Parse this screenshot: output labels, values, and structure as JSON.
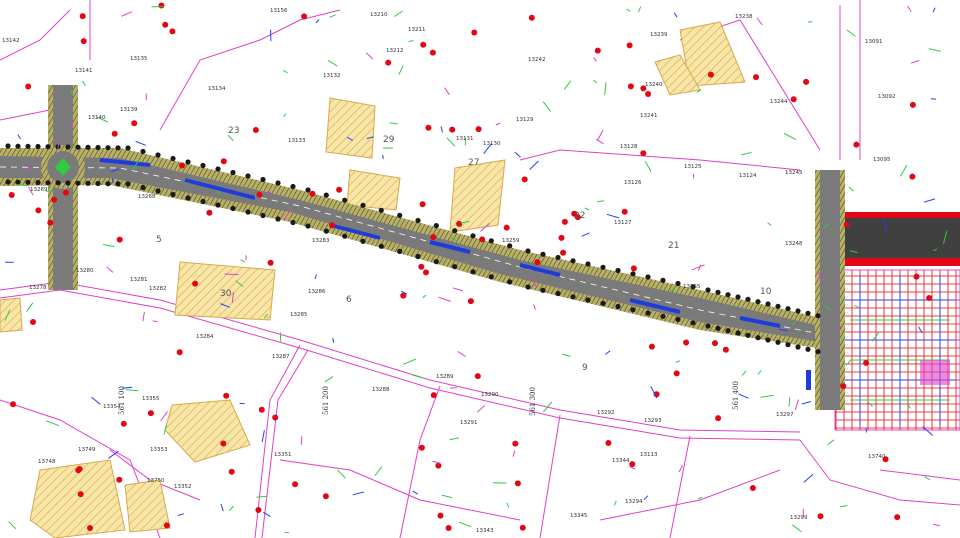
{
  "map": {
    "colors": {
      "background": "#ffffff",
      "property_lines": "#e040c8",
      "road_paving": "#7a7a7a",
      "road_edge_hatch": "#c8c070",
      "bus_lane": "#1e3cd8",
      "building_fill": "#f7e6a8",
      "building_hatch": "#d9a84a",
      "marker_red": "#e30613",
      "vegetation_green": "#2ecc40",
      "blue_features": "#1e40ff",
      "dark_block": "#404040"
    },
    "block_numbers": [
      "23",
      "29",
      "27",
      "22",
      "21",
      "10",
      "5",
      "30",
      "6",
      "9"
    ],
    "stations": [
      "561 100",
      "561 200",
      "561 300",
      "561 400"
    ],
    "parcels": [
      {
        "id": "13142"
      },
      {
        "id": "13141"
      },
      {
        "id": "13135"
      },
      {
        "id": "13156"
      },
      {
        "id": "13210"
      },
      {
        "id": "13211"
      },
      {
        "id": "13212"
      },
      {
        "id": "13134"
      },
      {
        "id": "13132"
      },
      {
        "id": "13139"
      },
      {
        "id": "13140"
      },
      {
        "id": "13133"
      },
      {
        "id": "13131"
      },
      {
        "id": "13130"
      },
      {
        "id": "13129"
      },
      {
        "id": "13242"
      },
      {
        "id": "13238"
      },
      {
        "id": "13239"
      },
      {
        "id": "13240"
      },
      {
        "id": "13241"
      },
      {
        "id": "13244"
      },
      {
        "id": "13091"
      },
      {
        "id": "13092"
      },
      {
        "id": "13128"
      },
      {
        "id": "13126"
      },
      {
        "id": "13125"
      },
      {
        "id": "13124"
      },
      {
        "id": "13245"
      },
      {
        "id": "13095"
      },
      {
        "id": "13127"
      },
      {
        "id": "13248"
      },
      {
        "id": "13269"
      },
      {
        "id": "13268"
      },
      {
        "id": "13283"
      },
      {
        "id": "13259"
      },
      {
        "id": "13280"
      },
      {
        "id": "13281"
      },
      {
        "id": "13282"
      },
      {
        "id": "13278"
      },
      {
        "id": "13286"
      },
      {
        "id": "13285"
      },
      {
        "id": "13255"
      },
      {
        "id": "13284"
      },
      {
        "id": "13287"
      },
      {
        "id": "13288"
      },
      {
        "id": "13289"
      },
      {
        "id": "13290"
      },
      {
        "id": "13292"
      },
      {
        "id": "13293"
      },
      {
        "id": "13291"
      },
      {
        "id": "13297"
      },
      {
        "id": "13740"
      },
      {
        "id": "13354"
      },
      {
        "id": "13355"
      },
      {
        "id": "13353"
      },
      {
        "id": "13749"
      },
      {
        "id": "13748"
      },
      {
        "id": "13750"
      },
      {
        "id": "13352"
      },
      {
        "id": "13351"
      },
      {
        "id": "13344"
      },
      {
        "id": "13343"
      },
      {
        "id": "13294"
      },
      {
        "id": "13299"
      },
      {
        "id": "13345"
      },
      {
        "id": "13113"
      }
    ]
  }
}
